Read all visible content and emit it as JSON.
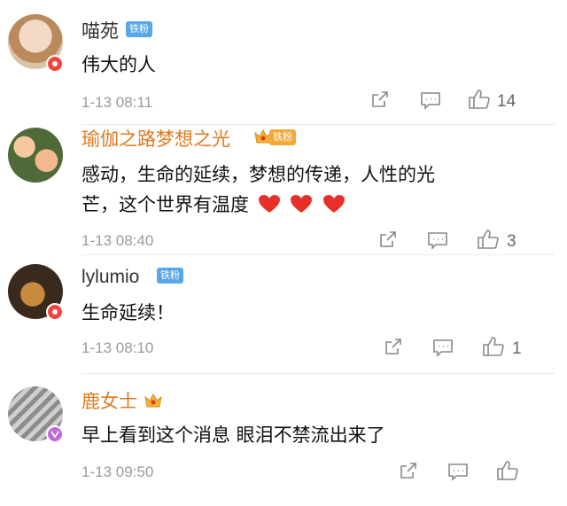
{
  "comments": [
    {
      "username": "喵苑",
      "badge_label": "铁粉",
      "text": "伟大的人",
      "time": "1-13 08:11",
      "likes": "14"
    },
    {
      "username": "瑜伽之路梦想之光",
      "badge_label": "铁粉",
      "text_line1": "感动，生命的延续，梦想的传递，人性的光",
      "text_line2": "芒，这个世界有温度",
      "time": "1-13 08:40",
      "likes": "3"
    },
    {
      "username": "lylumio",
      "badge_label": "铁粉",
      "text": "生命延续！",
      "time": "1-13 08:10",
      "likes": "1"
    },
    {
      "username": "鹿女士",
      "text": "早上看到这个消息 眼泪不禁流出来了",
      "time": "1-13 09:50",
      "likes": ""
    }
  ],
  "colors": {
    "vip_name": "#e07a1c",
    "fan_tag": "#59a6e8",
    "heart": "#e8302a"
  },
  "icons": [
    "share-icon",
    "comment-icon",
    "like-icon",
    "crown-icon",
    "heart-icon"
  ]
}
